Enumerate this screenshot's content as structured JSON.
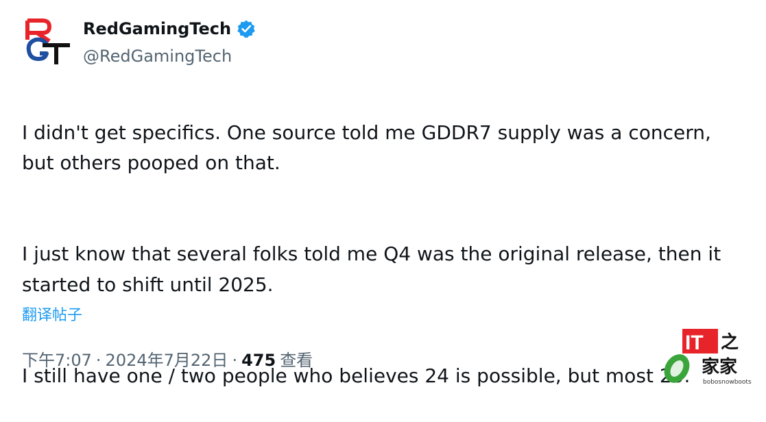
{
  "author": {
    "display_name": "RedGamingTech",
    "handle": "@RedGamingTech",
    "verified_icon": "verified-badge-icon",
    "avatar_logo_text": "RGT",
    "brand_red": "#e8242b",
    "brand_blue": "#1f4fa0"
  },
  "tweet": {
    "paragraphs": [
      "I didn't get specifics. One source told me GDDR7 supply was a concern,\nbut others pooped on that.",
      "I just know that several folks told me Q4 was the original release, then it\nstarted to shift until 2025.",
      "I still have one / two people who believes 24 is possible, but most 25."
    ],
    "translate_label": "翻译帖子"
  },
  "meta": {
    "time": "下午7:07",
    "separator": "·",
    "date": "2024年7月22日",
    "views_count": "475",
    "views_label": "查看"
  },
  "watermark": {
    "logo_text": "IT之家",
    "site_text": "bobosnowboots"
  },
  "colors": {
    "text": "#0f1419",
    "secondary": "#536471",
    "link": "#1d9bf0",
    "verified": "#1d9bf0"
  }
}
